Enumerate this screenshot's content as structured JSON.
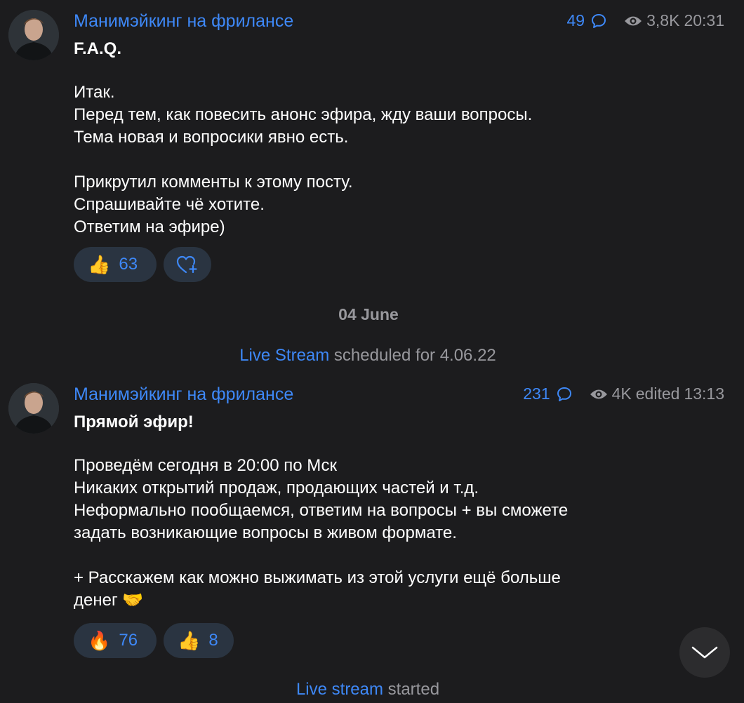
{
  "posts": [
    {
      "channel_name": "Манимэйкинг на фрилансе",
      "comments": "49",
      "views": "3,8K",
      "edited": "",
      "time": "20:31",
      "title": "F.A.Q.",
      "body": {
        "p1": [
          "Итак.",
          "Перед тем, как повесить анонс эфира, жду ваши вопросы.",
          "Тема новая и вопросики явно есть."
        ],
        "p2": [
          "Прикрутил комменты к этому посту.",
          "Спрашивайте чё хотите.",
          "Ответим на эфире)"
        ]
      },
      "reactions": [
        {
          "emoji": "👍",
          "count": "63"
        }
      ]
    },
    {
      "channel_name": "Манимэйкинг на фрилансе",
      "comments": "231",
      "views": "4K",
      "edited": "edited",
      "time": "13:13",
      "title": "Прямой эфир!",
      "body": {
        "p1": [
          "Проведём сегодня в 20:00 по Мск",
          "Никаких открытий продаж, продающих частей и т.д.",
          "Неформально пообщаемся, ответим на вопросы + вы сможете",
          "задать возникающие вопросы в живом формате."
        ],
        "p2": [
          "+ Расскажем как можно выжимать из этой услуги ещё больше",
          "денег 🤝"
        ]
      },
      "reactions": [
        {
          "emoji": "🔥",
          "count": "76"
        },
        {
          "emoji": "👍",
          "count": "8"
        }
      ]
    }
  ],
  "date_separator": "04 June",
  "service_1": {
    "link": "Live Stream",
    "text": " scheduled for 4.06.22"
  },
  "service_2": {
    "link": "Live stream",
    "text": " started"
  },
  "colors": {
    "accent": "#3e88f7",
    "background": "#1c1c1e",
    "muted": "#98989d",
    "reaction_bg": "#2a3441"
  }
}
